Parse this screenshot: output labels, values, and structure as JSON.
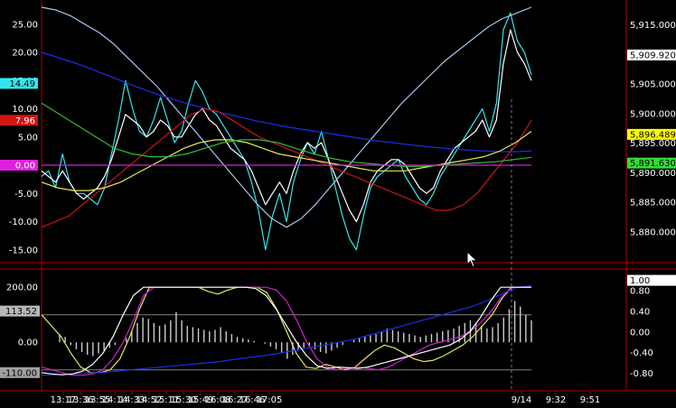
{
  "colors": {
    "background": "#000000",
    "frame": "#b00000",
    "axis_text": "#ffffff",
    "cyan": "#33e6ee",
    "white": "#ffffff",
    "light_blue": "#9fc7ee",
    "blue": "#1a2ee8",
    "red": "#d01515",
    "yellow": "#e6e65a",
    "green": "#33bb33",
    "magenta": "#d020d0",
    "gray": "#808080"
  },
  "cursor": {
    "icon": "mouse-pointer-icon"
  },
  "chart_data": [
    {
      "type": "line",
      "panel": "price",
      "left_ticks": [
        "25.00",
        "20.00",
        "15.00",
        "10.00",
        "5.00",
        "0.00",
        "-5.00",
        "-10.00",
        "-15.00"
      ],
      "right_ticks": [
        "5,915.000",
        "5,910.000",
        "5,905.000",
        "5,900.000",
        "5,895.000",
        "5,890.000",
        "5,885.000",
        "5,880.000"
      ],
      "ylim_left": [
        -16,
        28
      ],
      "ylim_right": [
        5876,
        5918
      ],
      "left_badges": [
        {
          "text": "14.49",
          "value": 14.49,
          "bg": "#33e6ee",
          "fg": "#000000"
        },
        {
          "text": "7.96",
          "value": 7.96,
          "bg": "#d01515",
          "fg": "#ffffff"
        },
        {
          "text": "0.00",
          "value": 0.0,
          "bg": "#e020e0",
          "fg": "#ffffff"
        }
      ],
      "right_badges": [
        {
          "text": "5,909.920",
          "value": 5909.92,
          "bg": "#ffffff",
          "fg": "#000000"
        },
        {
          "text": "5,896.489",
          "value": 5896.489,
          "bg": "#ffff00",
          "fg": "#000000"
        },
        {
          "text": "5,891.630",
          "value": 5891.63,
          "bg": "#33dd33",
          "fg": "#000000"
        }
      ],
      "series": [
        {
          "color": "#33e6ee",
          "axis": "left",
          "values": [
            -2,
            -1,
            -4,
            2,
            -3,
            -5,
            -5,
            -6,
            -7,
            -4,
            2,
            8,
            15,
            10,
            6,
            5,
            8,
            12,
            8,
            4,
            6,
            11,
            15,
            13,
            10,
            9,
            7,
            5,
            3,
            1,
            -3,
            -8,
            -15,
            -9,
            -5,
            -10,
            -3,
            1,
            4,
            2,
            6,
            1,
            -4,
            -9,
            -13,
            -15,
            -9,
            -4,
            -2,
            -1,
            0,
            1,
            -2,
            -4,
            -6,
            -7,
            -5,
            -2,
            0,
            2,
            4,
            6,
            8,
            10,
            6,
            11,
            24,
            27,
            22,
            20,
            16
          ]
        },
        {
          "color": "#ffffff",
          "axis": "left",
          "values": [
            -1,
            -2,
            -3,
            -1,
            -3,
            -5,
            -6,
            -5,
            -4,
            -2,
            1,
            5,
            9,
            8,
            7,
            5,
            6,
            8,
            7,
            5,
            5,
            7,
            9,
            10,
            8,
            7,
            5,
            3,
            2,
            1,
            -1,
            -4,
            -7,
            -5,
            -3,
            -5,
            -1,
            2,
            4,
            3,
            4,
            1,
            -2,
            -5,
            -8,
            -10,
            -7,
            -3,
            -1,
            0,
            1,
            1,
            0,
            -2,
            -4,
            -5,
            -4,
            -1,
            1,
            3,
            4,
            5,
            6,
            8,
            5,
            8,
            18,
            24,
            20,
            18,
            15
          ]
        },
        {
          "color": "#9fc7ee",
          "axis": "left",
          "values": [
            28,
            27.5,
            26.5,
            25,
            23.5,
            21.5,
            19,
            16.5,
            14,
            11,
            8,
            5,
            2,
            -1,
            -4,
            -7,
            -9.5,
            -11,
            -9.5,
            -7,
            -4,
            -1,
            2,
            5,
            8,
            11,
            13.5,
            16,
            18.5,
            20.5,
            22.5,
            24.5,
            26,
            27,
            28
          ]
        },
        {
          "color": "#1a2ee8",
          "axis": "left",
          "values": [
            20,
            19.2,
            18.4,
            17.5,
            16.5,
            15.5,
            14.5,
            13.5,
            12.6,
            11.8,
            11,
            10.3,
            9.6,
            9,
            8.4,
            7.8,
            7.3,
            6.8,
            6.4,
            6,
            5.6,
            5.2,
            4.8,
            4.4,
            4.1,
            3.8,
            3.5,
            3.2,
            3,
            2.8,
            2.6,
            2.5,
            2.4,
            2.4,
            2.5
          ]
        },
        {
          "color": "#d01515",
          "axis": "left",
          "values": [
            -11,
            -10,
            -9,
            -7,
            -5,
            -3,
            -1,
            1,
            3,
            5,
            7,
            9,
            10,
            9.5,
            8,
            6.5,
            5,
            4,
            3,
            2,
            1,
            0,
            -1,
            -2,
            -3,
            -4,
            -5,
            -6,
            -7,
            -8,
            -8,
            -7,
            -5,
            -2,
            1,
            4,
            8
          ]
        },
        {
          "color": "#e6e65a",
          "axis": "left",
          "values": [
            -3,
            -4,
            -4.5,
            -4.5,
            -4,
            -3,
            -1.5,
            0,
            1.5,
            3,
            4,
            4.5,
            4.5,
            4,
            3,
            2,
            1.5,
            1,
            0.5,
            0,
            -0.5,
            -1,
            -1,
            -1,
            -0.5,
            0,
            0.5,
            1,
            1.5,
            2.5,
            4,
            6
          ]
        },
        {
          "color": "#33bb33",
          "axis": "left",
          "values": [
            11,
            9,
            7,
            5,
            3,
            2,
            1.5,
            1.5,
            2,
            3,
            4,
            4.5,
            4.5,
            4,
            3,
            2,
            1.2,
            0.6,
            0.3,
            0,
            -0.2,
            -0.2,
            0,
            0.2,
            0.4,
            0.6,
            1,
            1.4
          ]
        },
        {
          "color": "#d020d0",
          "axis": "left",
          "values": [
            0,
            0
          ]
        }
      ]
    },
    {
      "type": "line",
      "panel": "oscillator",
      "left_ticks": [
        "200.00",
        "113.52",
        "0.00",
        "-110.00"
      ],
      "right_ticks": [
        "1.00",
        "0.80",
        "0.40",
        "0.00",
        "-0.40",
        "-0.80"
      ],
      "ylim_left": [
        -150,
        240
      ],
      "ylim_right": [
        -1.0,
        1.08
      ],
      "left_badges": [
        {
          "text": "113.52",
          "value": 113.52,
          "bg": "#b8b8b8",
          "fg": "#000000"
        },
        {
          "text": "-110.00",
          "value": -110.0,
          "bg": "#a0a0a0",
          "fg": "#000000"
        }
      ],
      "right_badges": [
        {
          "text": "1.00",
          "value": 1.0,
          "bg": "#ffffff",
          "fg": "#000000"
        }
      ],
      "reference_lines": [
        100,
        -100
      ],
      "histogram": {
        "color": "#cccccc",
        "values": [
          30,
          20,
          -10,
          -25,
          -35,
          -45,
          -50,
          -40,
          -30,
          -20,
          -10,
          0,
          15,
          40,
          70,
          90,
          85,
          70,
          60,
          65,
          80,
          110,
          80,
          60,
          55,
          50,
          45,
          40,
          45,
          55,
          40,
          30,
          20,
          15,
          10,
          5,
          0,
          -5,
          -15,
          -25,
          -40,
          -60,
          -45,
          -30,
          -20,
          -15,
          -25,
          -35,
          -40,
          -30,
          -20,
          -10,
          0,
          10,
          15,
          20,
          25,
          30,
          40,
          50,
          45,
          40,
          35,
          30,
          25,
          20,
          25,
          30,
          35,
          40,
          45,
          50,
          60,
          70,
          80,
          70,
          60,
          50,
          55,
          70,
          90,
          120,
          150,
          130,
          100,
          80
        ]
      },
      "series": [
        {
          "color": "#e6e65a",
          "axis": "left",
          "values": [
            100,
            60,
            20,
            -40,
            -90,
            -110,
            -110,
            -100,
            -60,
            20,
            120,
            200,
            200,
            200,
            200,
            200,
            200,
            185,
            175,
            190,
            200,
            200,
            200,
            180,
            120,
            40,
            -40,
            -90,
            -95,
            -80,
            -90,
            -100,
            -90,
            -60,
            -30,
            -10,
            -20,
            -40,
            -60,
            -70,
            -65,
            -50,
            -30,
            -10,
            20,
            60,
            100,
            160,
            200,
            200,
            200
          ]
        },
        {
          "color": "#d020d0",
          "axis": "left",
          "values": [
            -90,
            -100,
            -110,
            -120,
            -120,
            -115,
            -100,
            -60,
            0,
            80,
            170,
            200,
            200,
            200,
            200,
            200,
            200,
            200,
            200,
            200,
            200,
            200,
            200,
            190,
            150,
            80,
            0,
            -60,
            -90,
            -100,
            -95,
            -90,
            -95,
            -100,
            -90,
            -70,
            -50,
            -30,
            -10,
            0,
            10,
            20,
            40,
            70,
            110,
            160,
            200,
            200,
            200
          ]
        },
        {
          "color": "#1a2ee8",
          "axis": "left",
          "values": [
            -120,
            -118,
            -115,
            -112,
            -110,
            -105,
            -100,
            -95,
            -90,
            -85,
            -80,
            -75,
            -70,
            -62,
            -55,
            -48,
            -40,
            -30,
            -20,
            -10,
            0,
            10,
            25,
            40,
            55,
            70,
            85,
            100,
            115,
            130,
            150,
            175,
            200,
            205
          ]
        },
        {
          "color": "#ffffff",
          "axis": "left",
          "values": [
            -110,
            -115,
            -118,
            -115,
            -105,
            -80,
            -40,
            20,
            100,
            170,
            200,
            200,
            200,
            200,
            200,
            200,
            200,
            200,
            200,
            200,
            200,
            195,
            170,
            120,
            60,
            0,
            -50,
            -85,
            -95,
            -90,
            -92,
            -95,
            -90,
            -80,
            -70,
            -60,
            -50,
            -40,
            -30,
            -20,
            -10,
            10,
            40,
            90,
            150,
            200,
            200,
            200,
            200
          ]
        }
      ]
    }
  ],
  "x_axis": {
    "tick_labels": [
      "13:17",
      "13:36",
      "13:55",
      "14:14",
      "14:33",
      "14:52",
      "15:11",
      "15:30",
      "15:49",
      "16:08",
      "16:27",
      "16:46",
      "17:05",
      "9/14",
      "9:32",
      "9:51"
    ],
    "session_break_label": "9/14"
  }
}
